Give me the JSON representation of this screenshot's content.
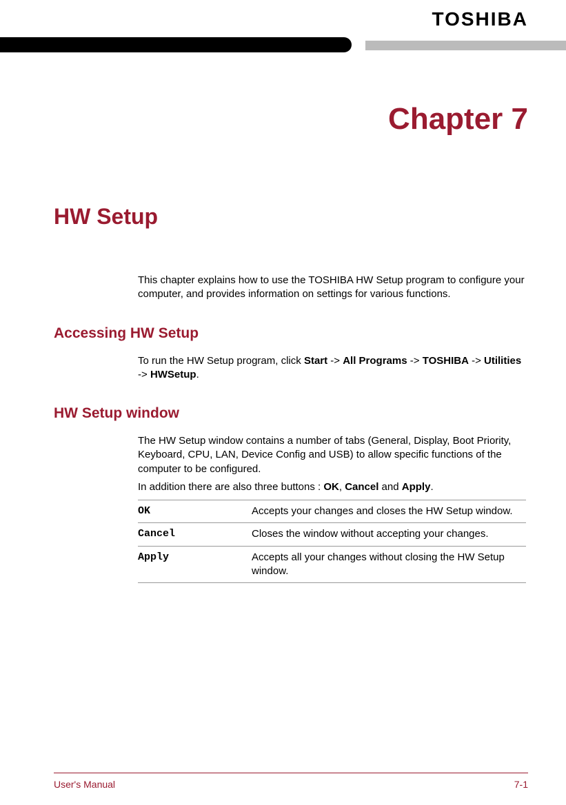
{
  "header": {
    "brand": "TOSHIBA"
  },
  "chapter": {
    "title": "Chapter 7"
  },
  "main": {
    "heading": "HW Setup",
    "intro": "This chapter explains how to use the TOSHIBA HW Setup program to configure your computer, and provides information on settings for various functions."
  },
  "sections": {
    "accessing": {
      "heading": "Accessing HW Setup",
      "text_pre": "To run the HW Setup program, click ",
      "nav": {
        "start": "Start",
        "allprograms": "All Programs",
        "toshiba": "TOSHIBA",
        "utilities": "Utilities",
        "hwsetup": "HWSetup"
      },
      "arrow": " -> "
    },
    "window": {
      "heading": "HW Setup window",
      "para1": "The HW Setup window contains a number of tabs (General, Display, Boot Priority, Keyboard, CPU, LAN, Device Config and USB) to allow specific functions of the computer to be configured.",
      "para2_pre": "In addition there are also three buttons : ",
      "para2_ok": "OK",
      "para2_sep1": ", ",
      "para2_cancel": "Cancel",
      "para2_sep2": " and ",
      "para2_apply": "Apply",
      "para2_post": ".",
      "buttons": [
        {
          "label": "OK",
          "desc": "Accepts your changes and closes the HW Setup window."
        },
        {
          "label": "Cancel",
          "desc": "Closes the window without accepting your changes."
        },
        {
          "label": "Apply",
          "desc": "Accepts all your changes without closing the HW Setup window."
        }
      ]
    }
  },
  "footer": {
    "left": "User's Manual",
    "right": "7-1"
  }
}
